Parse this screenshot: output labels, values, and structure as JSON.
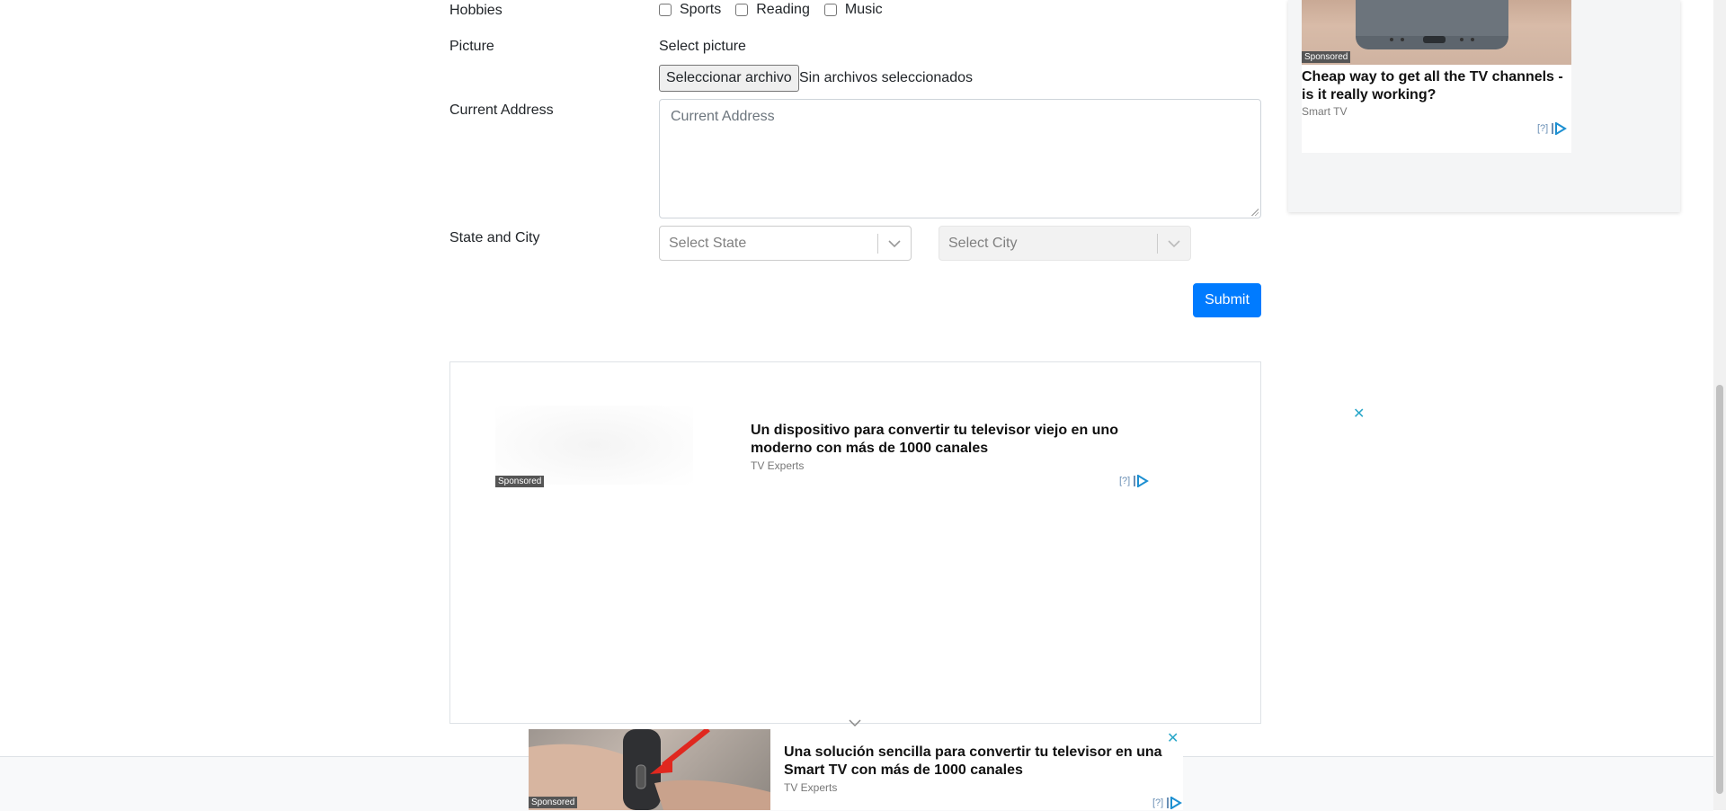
{
  "form": {
    "hobbies_label": "Hobbies",
    "hobbies": [
      "Sports",
      "Reading",
      "Music"
    ],
    "picture_label": "Picture",
    "picture_hint": "Select picture",
    "file_button": "Seleccionar archivo",
    "file_status": "Sin archivos seleccionados",
    "address_label": "Current Address",
    "address_placeholder": "Current Address",
    "state_city_label": "State and City",
    "state_placeholder": "Select State",
    "city_placeholder": "Select City",
    "submit_label": "Submit"
  },
  "ads": {
    "middle": {
      "title": "Un dispositivo para convertir tu televisor viejo en uno moderno con más de 1000 canales",
      "source": "TV Experts",
      "sponsored": "Sponsored",
      "choices": "[?]"
    },
    "side": {
      "title": "Cheap way to get all the TV channels - is it really working?",
      "source": "Smart TV",
      "sponsored": "Sponsored",
      "choices": "[?]"
    },
    "bottom": {
      "title": "Una solución sencilla para convertir tu televisor en una Smart TV con más de 1000 canales",
      "source": "TV Experts",
      "sponsored": "Sponsored",
      "choices": "[?]"
    }
  },
  "icons": {
    "close": "close-icon",
    "chevron": "chevron-down-icon",
    "adchoices": "adchoices-icon"
  },
  "colors": {
    "primary": "#007bff",
    "close_accent": "#2aa7c9"
  }
}
